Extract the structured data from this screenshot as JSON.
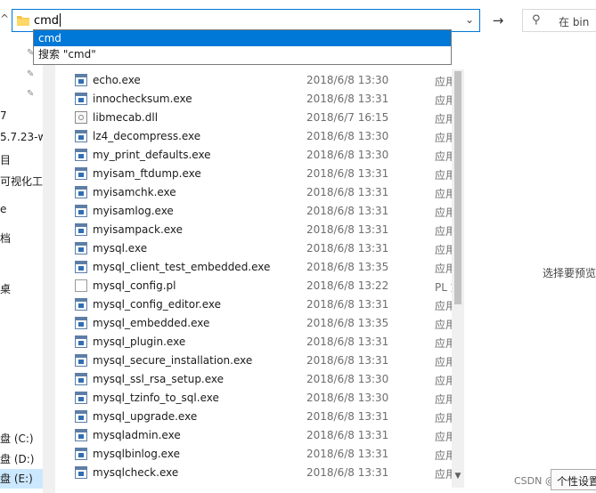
{
  "address": {
    "value": "cmd"
  },
  "autocomplete": {
    "items": [
      "cmd",
      "搜索 \"cmd\""
    ]
  },
  "search": {
    "placeholder": "在 bin"
  },
  "nav": {
    "items": [
      "7",
      "5.7.23-w",
      "目",
      "可视化工",
      "e",
      "档",
      "桌",
      "盘 (C:)",
      "盘 (D:)",
      "盘 (E:)"
    ]
  },
  "files": [
    {
      "name": "echo.exe",
      "date": "2018/6/8 13:30",
      "type": "应用",
      "icon": "exe"
    },
    {
      "name": "innochecksum.exe",
      "date": "2018/6/8 13:31",
      "type": "应用",
      "icon": "exe"
    },
    {
      "name": "libmecab.dll",
      "date": "2018/6/7 16:15",
      "type": "应用",
      "icon": "dll"
    },
    {
      "name": "lz4_decompress.exe",
      "date": "2018/6/8 13:30",
      "type": "应用",
      "icon": "exe"
    },
    {
      "name": "my_print_defaults.exe",
      "date": "2018/6/8 13:30",
      "type": "应用",
      "icon": "exe"
    },
    {
      "name": "myisam_ftdump.exe",
      "date": "2018/6/8 13:31",
      "type": "应用",
      "icon": "exe"
    },
    {
      "name": "myisamchk.exe",
      "date": "2018/6/8 13:31",
      "type": "应用",
      "icon": "exe"
    },
    {
      "name": "myisamlog.exe",
      "date": "2018/6/8 13:31",
      "type": "应用",
      "icon": "exe"
    },
    {
      "name": "myisampack.exe",
      "date": "2018/6/8 13:31",
      "type": "应用",
      "icon": "exe"
    },
    {
      "name": "mysql.exe",
      "date": "2018/6/8 13:31",
      "type": "应用",
      "icon": "exe"
    },
    {
      "name": "mysql_client_test_embedded.exe",
      "date": "2018/6/8 13:35",
      "type": "应用",
      "icon": "exe"
    },
    {
      "name": "mysql_config.pl",
      "date": "2018/6/8 13:22",
      "type": "PL 文",
      "icon": "doc"
    },
    {
      "name": "mysql_config_editor.exe",
      "date": "2018/6/8 13:31",
      "type": "应用",
      "icon": "exe"
    },
    {
      "name": "mysql_embedded.exe",
      "date": "2018/6/8 13:35",
      "type": "应用",
      "icon": "exe"
    },
    {
      "name": "mysql_plugin.exe",
      "date": "2018/6/8 13:31",
      "type": "应用",
      "icon": "exe"
    },
    {
      "name": "mysql_secure_installation.exe",
      "date": "2018/6/8 13:31",
      "type": "应用",
      "icon": "exe"
    },
    {
      "name": "mysql_ssl_rsa_setup.exe",
      "date": "2018/6/8 13:30",
      "type": "应用",
      "icon": "exe"
    },
    {
      "name": "mysql_tzinfo_to_sql.exe",
      "date": "2018/6/8 13:30",
      "type": "应用",
      "icon": "exe"
    },
    {
      "name": "mysql_upgrade.exe",
      "date": "2018/6/8 13:31",
      "type": "应用",
      "icon": "exe"
    },
    {
      "name": "mysqladmin.exe",
      "date": "2018/6/8 13:31",
      "type": "应用",
      "icon": "exe"
    },
    {
      "name": "mysqlbinlog.exe",
      "date": "2018/6/8 13:31",
      "type": "应用",
      "icon": "exe"
    },
    {
      "name": "mysqlcheck.exe",
      "date": "2018/6/8 13:31",
      "type": "应用",
      "icon": "exe"
    }
  ],
  "preview": {
    "text": "选择要预览"
  },
  "watermark": "CSDN @野生",
  "tooltip": "个性设置"
}
